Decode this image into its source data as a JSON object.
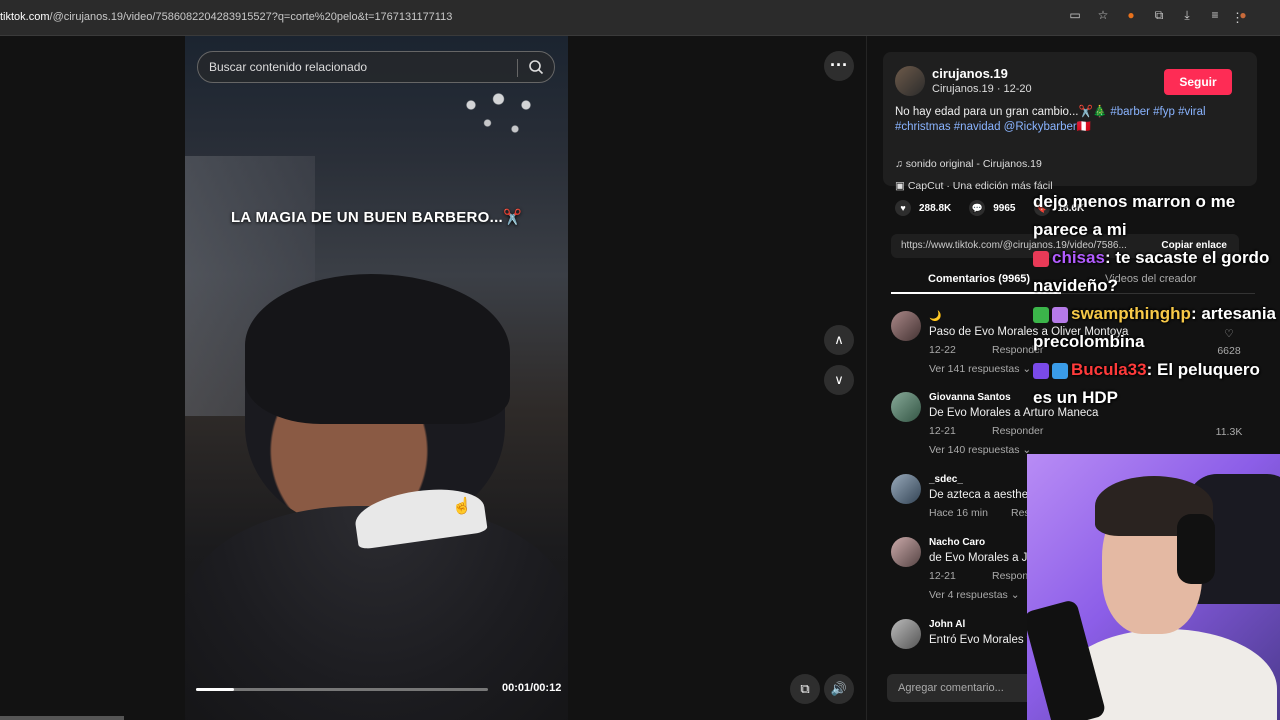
{
  "browser": {
    "url_host": "tiktok.com",
    "url_path": "/@cirujanos.19/video/7586082204283915527?q=corte%20pelo&t=1767131177113",
    "icons": [
      "cast-icon",
      "star-icon",
      "extension-icon",
      "puzzle-icon",
      "download-icon",
      "media-icon",
      "profile-icon"
    ]
  },
  "video": {
    "search_placeholder": "Buscar contenido relacionado",
    "caption": "LA MAGIA DE UN BUEN BARBERO...✂️",
    "time": "00:01/00:12",
    "progress": 0.13
  },
  "post": {
    "username": "cirujanos.19",
    "subtitle": "Cirujanos.19 · 12-20",
    "follow_label": "Seguir",
    "desc_text": "No hay edad para un gran cambio...✂️🎄 ",
    "desc_tags": "#barber #fyp #viral #christmas #navidad @Rickybarber🇵🇪",
    "sound": "sonido original - Cirujanos.19",
    "capcut": "CapCut · Una edición más fácil",
    "likes": "288.8K",
    "comments": "9965",
    "saves": "18.6K",
    "link": "https://www.tiktok.com/@cirujanos.19/video/7586...",
    "copy_label": "Copiar enlace",
    "tab_comments": "Comentarios (9965)",
    "tab_videos": "Videos del creador"
  },
  "comments": [
    {
      "name": "🌙",
      "text": "Paso de Evo Morales a Oliver Montoya",
      "date": "12-22",
      "reply": "Responder",
      "more": "Ver 141 respuestas ⌄",
      "likes": "6628"
    },
    {
      "name": "Giovanna Santos",
      "text": "De Evo Morales a Arturo Maneca",
      "date": "12-21",
      "reply": "Responder",
      "more": "Ver 140 respuestas ⌄",
      "likes": "11.3K"
    },
    {
      "name": "_sdec_",
      "text": "De azteca a aesthe",
      "date": "Hace 16 min",
      "reply": "Respo",
      "more": "",
      "likes": ""
    },
    {
      "name": "Nacho Caro",
      "text": "de Evo Morales a J",
      "date": "12-21",
      "reply": "Responder",
      "more": "Ver 4 respuestas ⌄",
      "likes": ""
    },
    {
      "name": "John Al",
      "text": "Entró Evo Morales y",
      "date": "",
      "reply": "",
      "more": "",
      "likes": ""
    }
  ],
  "add_comment_placeholder": "Agregar comentario...",
  "chat": {
    "line0": "dejo menos marron o me",
    "line0b": "parece a mi",
    "u_chisas": "chisas",
    "msg_chisas": ": te sacaste el gordo navideño?",
    "u_swamp": "swampthinghp",
    "msg_swamp": ": artesania precolombina",
    "u_bucula": "Bucula33",
    "msg_bucula": ": El peluquero es un HDP"
  },
  "colors": {
    "accent": "#fe2c55",
    "tag": "#8ab4ff"
  }
}
